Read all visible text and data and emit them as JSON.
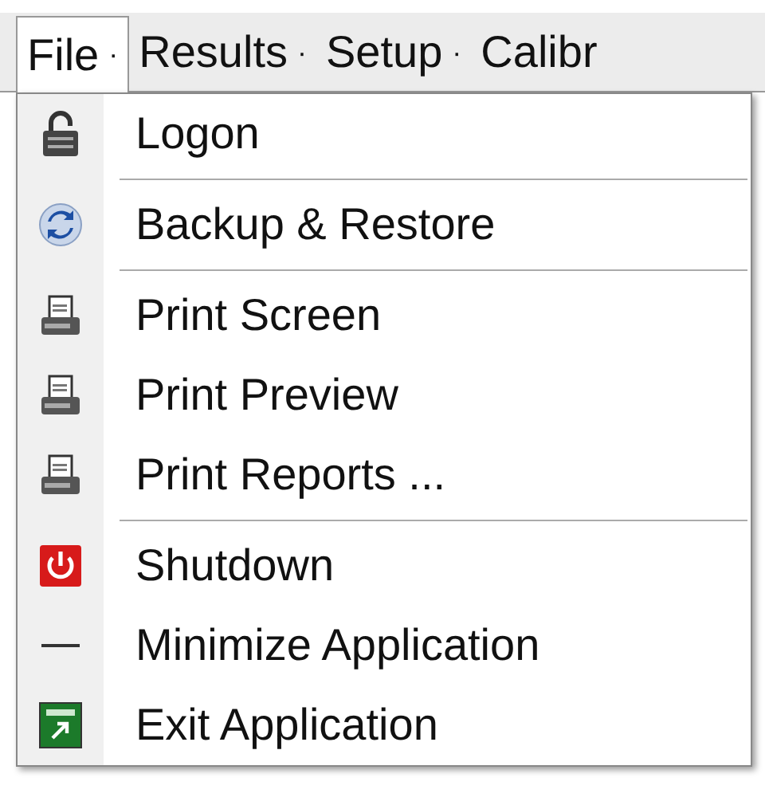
{
  "menubar": [
    {
      "label": "File",
      "marker": "·",
      "selected": true
    },
    {
      "label": "Results",
      "marker": "·",
      "selected": false
    },
    {
      "label": "Setup",
      "marker": "·",
      "selected": false
    },
    {
      "label": "Calibr",
      "selected": false
    }
  ],
  "menu": {
    "sections": [
      [
        {
          "label": "Logon",
          "kind": "lock"
        }
      ],
      [
        {
          "label": "Backup & Restore",
          "kind": "sync"
        }
      ],
      [
        {
          "label": "Print Screen",
          "kind": "printer"
        },
        {
          "label": "Print Preview",
          "kind": "printer"
        },
        {
          "label": "Print Reports ...",
          "kind": "printer"
        }
      ],
      [
        {
          "label": "Shutdown",
          "kind": "power"
        },
        {
          "label": "Minimize Application",
          "kind": "minimize"
        },
        {
          "label": "Exit Application",
          "kind": "exit"
        }
      ]
    ]
  }
}
